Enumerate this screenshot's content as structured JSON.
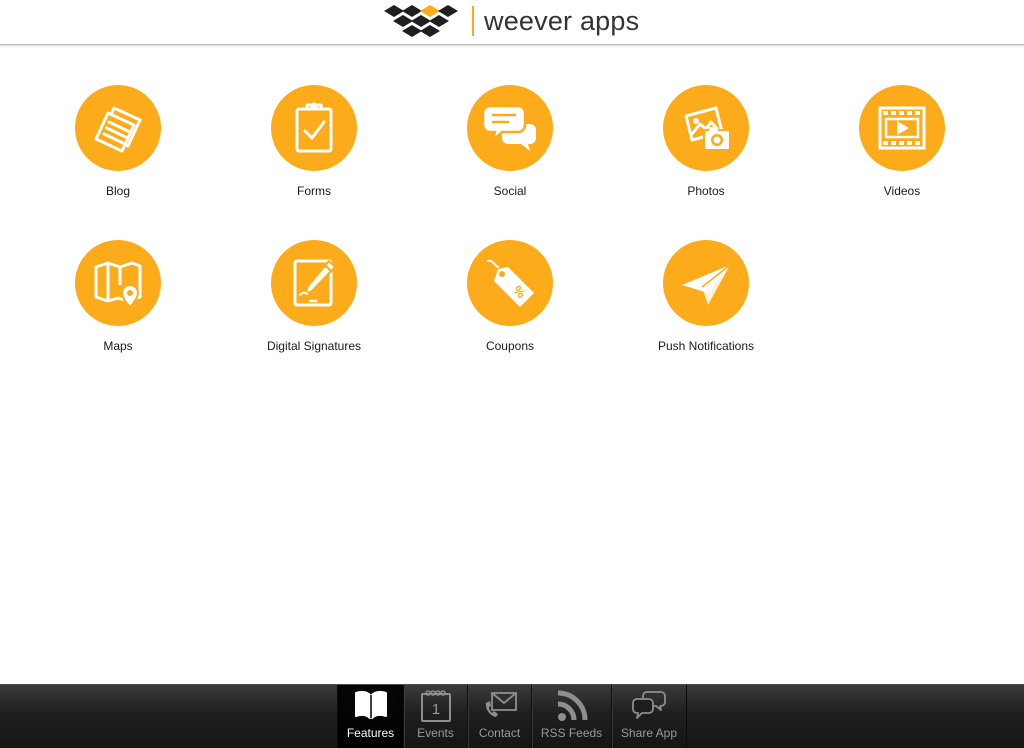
{
  "app": {
    "brand_text": "weever apps",
    "colors": {
      "accent": "#FCAB1A",
      "icon_fg": "#FFFFFF",
      "header_bg": "#FFFFFF",
      "tabbar_bg": "#1E1E1E",
      "tab_active_label": "#FFFFFF",
      "tab_inactive_label": "#9A9A9A"
    }
  },
  "features": [
    {
      "label": "Blog",
      "icon": "newspaper-icon"
    },
    {
      "label": "Forms",
      "icon": "clipboard-check-icon"
    },
    {
      "label": "Social",
      "icon": "chat-bubbles-icon"
    },
    {
      "label": "Photos",
      "icon": "photo-camera-icon"
    },
    {
      "label": "Videos",
      "icon": "film-play-icon"
    },
    {
      "label": "Maps",
      "icon": "map-pin-icon"
    },
    {
      "label": "Digital Signatures",
      "icon": "tablet-pen-icon"
    },
    {
      "label": "Coupons",
      "icon": "coupon-tag-icon"
    },
    {
      "label": "Push Notifications",
      "icon": "paper-plane-icon"
    }
  ],
  "tabbar": {
    "tabs": [
      {
        "label": "Features",
        "icon": "open-book-icon",
        "active": true
      },
      {
        "label": "Events",
        "icon": "calendar-icon",
        "calendar_day": "1",
        "active": false
      },
      {
        "label": "Contact",
        "icon": "phone-envelope-icon",
        "active": false
      },
      {
        "label": "RSS Feeds",
        "icon": "rss-icon",
        "active": false
      },
      {
        "label": "Share App",
        "icon": "share-bubbles-icon",
        "active": false
      }
    ]
  }
}
